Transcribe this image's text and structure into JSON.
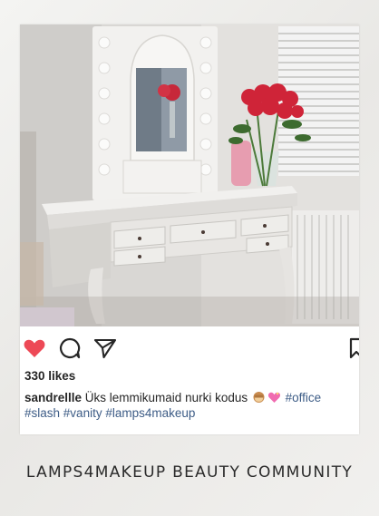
{
  "post": {
    "likes_text": "330 likes",
    "username": "sandrellle",
    "caption_text": "Üks lemmikumaid nurki kodus",
    "emojis": [
      "monkey-face-emoji",
      "heart-emoji"
    ],
    "hashtags": [
      "#office",
      "#slash",
      "#vanity",
      "#lamps4makeup"
    ],
    "liked": true,
    "like_color": "#ed4956"
  },
  "actions": {
    "like_icon": "heart-icon",
    "comment_icon": "comment-icon",
    "share_icon": "send-icon",
    "save_icon": "bookmark-icon"
  },
  "footer": {
    "title": "LAMPS4MAKEUP BEAUTY COMMUNITY"
  },
  "photo": {
    "subject": "photo-vanity-desk",
    "colors": {
      "wall": "#dedcd9",
      "desk": "#e7e4e1",
      "roses": "#d0263a",
      "vase": "#e79db0"
    }
  }
}
